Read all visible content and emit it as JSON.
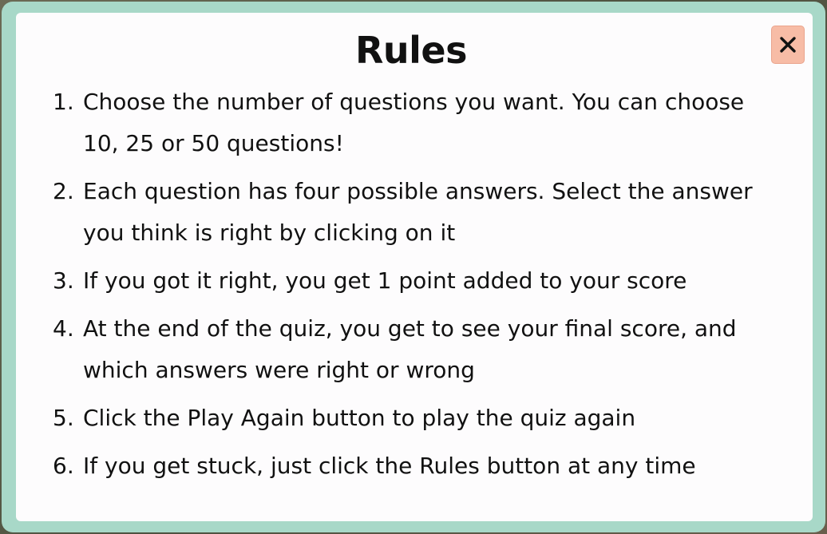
{
  "modal": {
    "title": "Rules",
    "close_label": "close"
  },
  "rules": [
    {
      "num": "1.",
      "text": "Choose the number of questions you want. You can choose 10, 25 or 50 questions!"
    },
    {
      "num": "2.",
      "text": "Each question has four possible answers. Select the answer you think is right by clicking on it"
    },
    {
      "num": "3.",
      "text": "If you got it right, you get 1 point added to your score"
    },
    {
      "num": "4.",
      "text": "At the end of the quiz, you get to see your final score, and which answers were right or wrong"
    },
    {
      "num": "5.",
      "text": "Click the Play Again button to play the quiz again"
    },
    {
      "num": "6.",
      "text": "If you get stuck, just click the Rules button at any time"
    }
  ],
  "colors": {
    "frame": "#a8d8c8",
    "panel": "#fdfcfd",
    "close_button": "#f7bca6",
    "text": "#111111"
  },
  "icons": {
    "close": "close-icon"
  }
}
